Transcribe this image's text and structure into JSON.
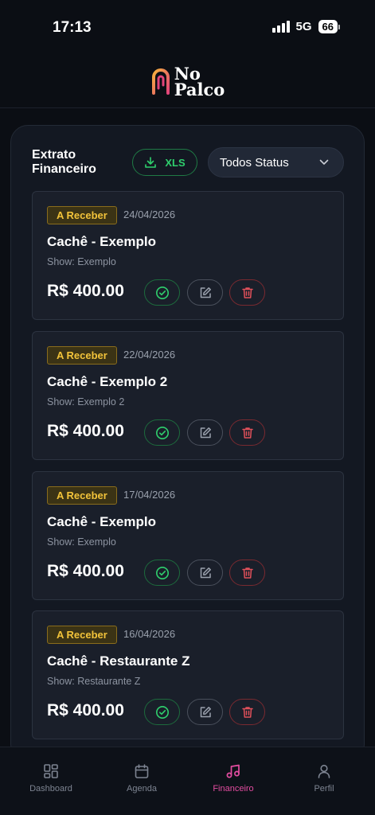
{
  "status_bar": {
    "time": "17:13",
    "network": "5G",
    "battery": "66"
  },
  "app": {
    "logo_line1": "No",
    "logo_line2": "Palco"
  },
  "extrato": {
    "title": "Extrato Financeiro",
    "export_label": "XLS",
    "filter_value": "Todos Status"
  },
  "entries": [
    {
      "status": "A Receber",
      "date": "24/04/2026",
      "title": "Cachê - Exemplo",
      "show": "Show: Exemplo",
      "amount": "R$ 400.00"
    },
    {
      "status": "A Receber",
      "date": "22/04/2026",
      "title": "Cachê - Exemplo 2",
      "show": "Show: Exemplo 2",
      "amount": "R$ 400.00"
    },
    {
      "status": "A Receber",
      "date": "17/04/2026",
      "title": "Cachê - Exemplo",
      "show": "Show: Exemplo",
      "amount": "R$ 400.00"
    },
    {
      "status": "A Receber",
      "date": "16/04/2026",
      "title": "Cachê - Restaurante Z",
      "show": "Show: Restaurante Z",
      "amount": "R$ 400.00"
    }
  ],
  "nav": {
    "items": [
      {
        "label": "Dashboard",
        "icon": "grid-icon"
      },
      {
        "label": "Agenda",
        "icon": "calendar-icon"
      },
      {
        "label": "Financeiro",
        "icon": "music-note-icon"
      },
      {
        "label": "Perfil",
        "icon": "user-icon"
      }
    ],
    "active": "Financeiro"
  },
  "colors": {
    "background": "#0b0e14",
    "panel": "#131822",
    "card": "#1a1f2a",
    "accent_green": "#2fcf6d",
    "badge_yellow": "#f2c33a",
    "delete_red": "#e0505a",
    "active_pink": "#e44da1"
  }
}
